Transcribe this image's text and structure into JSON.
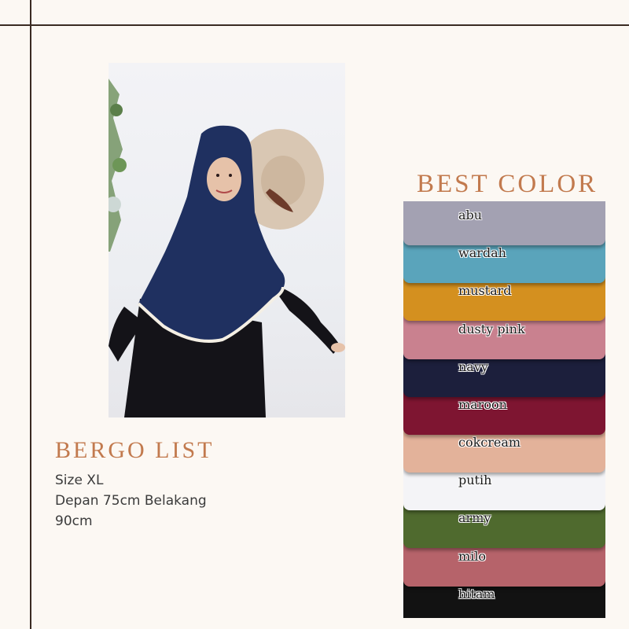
{
  "product": {
    "title": "BERGO LIST",
    "size": "Size XL",
    "dimensions_line1": "Depan 75cm Belakang",
    "dimensions_line2": "90cm"
  },
  "colors_section": {
    "title": "BEST COLOR",
    "swatches": [
      {
        "label": "abu",
        "color": "#a3a1b2"
      },
      {
        "label": "wardah",
        "color": "#5aa4bb"
      },
      {
        "label": "mustard",
        "color": "#d4901f"
      },
      {
        "label": "dusty pink",
        "color": "#c9818f"
      },
      {
        "label": "navy",
        "color": "#1c1f3c"
      },
      {
        "label": "maroon",
        "color": "#7e1531"
      },
      {
        "label": "cokcream",
        "color": "#e3b29a"
      },
      {
        "label": "putih",
        "color": "#f4f4f7"
      },
      {
        "label": "army",
        "color": "#4f6a2e"
      },
      {
        "label": "milo",
        "color": "#b6636a"
      },
      {
        "label": "hitam",
        "color": "#121212"
      }
    ]
  },
  "photo": {
    "hijab_color": "#1f3060",
    "icon": "model-wearing-hijab-photo"
  }
}
